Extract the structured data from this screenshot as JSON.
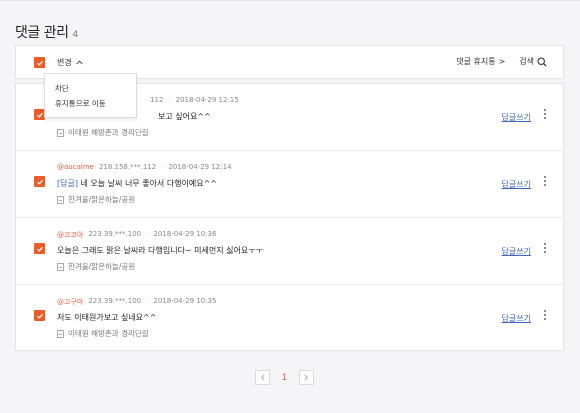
{
  "page": {
    "title": "댓글 관리",
    "count": "4"
  },
  "toolbar": {
    "change_label": "변경",
    "trash_label": "댓글 휴지통",
    "trash_arrow": ">",
    "search_label": "검색"
  },
  "dropdown": {
    "items": [
      "차단",
      "휴지통으로 이동"
    ]
  },
  "comments": [
    {
      "author": "",
      "ip": "112",
      "date": "2018-04-29 12:15",
      "tag": "",
      "text": "보고 싶어요^^",
      "board": "이태원 해방촌과 경리단길",
      "reply_label": "답글쓰기"
    },
    {
      "author": "@aucalme",
      "ip": "218.158.***.112",
      "date": "2018-04-29 12:14",
      "tag": "[답글]",
      "text": " 네 오늘 날씨 너무 좋아서 다행이예요^^",
      "board": "한겨울/맑은하늘/공원",
      "reply_label": "답글쓰기"
    },
    {
      "author": "@코코아",
      "ip": "223.39.***.100",
      "date": "2018-04-29 10:36",
      "tag": "",
      "text": "오늘은 그래도 맑은 날씨라 다행입니다~ 미세먼지 싫어요ㅜㅜ",
      "board": "한겨울/맑은하늘/공원",
      "reply_label": "답글쓰기"
    },
    {
      "author": "@고구마",
      "ip": "223.39.***.100",
      "date": "2018-04-29 10:35",
      "tag": "",
      "text": "저도 이태원가보고 싶네요^^",
      "board": "이태원 해방촌과 경리단길",
      "reply_label": "답글쓰기"
    }
  ],
  "pagination": {
    "current": "1"
  },
  "colors": {
    "accent": "#f15a24",
    "link": "#3d66c4"
  }
}
